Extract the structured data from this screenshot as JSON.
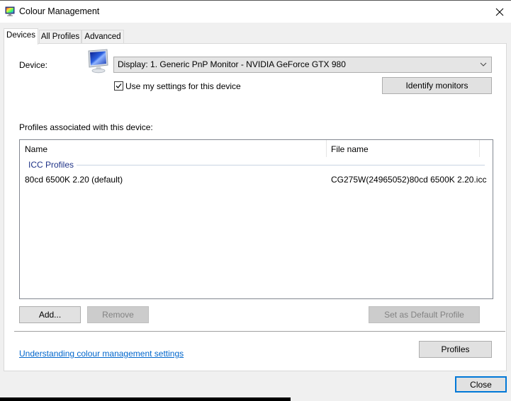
{
  "window": {
    "title": "Colour Management",
    "app_icon": "colour-management-monitor-icon",
    "close_icon": "close-icon"
  },
  "tabs": [
    {
      "label": "Devices",
      "active": true
    },
    {
      "label": "All Profiles",
      "active": false
    },
    {
      "label": "Advanced",
      "active": false
    }
  ],
  "device": {
    "label": "Device:",
    "icon": "monitor-icon",
    "selected": "Display: 1. Generic PnP Monitor - NVIDIA GeForce GTX 980",
    "use_my_settings_label": "Use my settings for this device",
    "use_my_settings_checked": true,
    "identify_button": "Identify monitors"
  },
  "profiles": {
    "section_label": "Profiles associated with this device:",
    "columns": [
      "Name",
      "File name"
    ],
    "groups": [
      {
        "label": "ICC Profiles",
        "rows": [
          {
            "name": "80cd 6500K 2.20 (default)",
            "file_name": "CG275W(24965052)80cd 6500K 2.20.icc"
          }
        ]
      }
    ]
  },
  "buttons": {
    "add": "Add...",
    "remove": "Remove",
    "set_default": "Set as Default Profile",
    "profiles": "Profiles",
    "close": "Close"
  },
  "link": {
    "understanding": "Understanding colour management settings"
  },
  "colors": {
    "accent": "#0078d7",
    "link": "#0066cc",
    "group_label": "#1e3287"
  }
}
